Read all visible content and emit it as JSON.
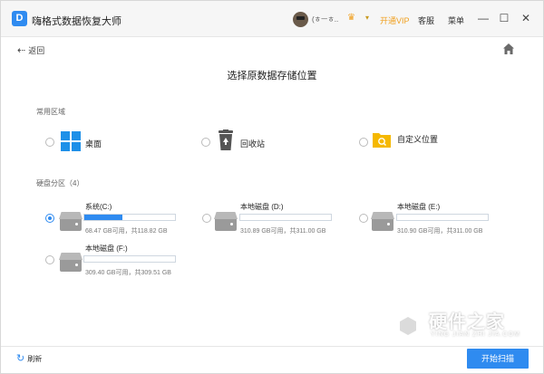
{
  "titlebar": {
    "app_title": "嗨格式数据恢复大师",
    "logo_letter": "D",
    "user_name": "(ㅎㅡㅎ..",
    "vip_label": "开通VIP",
    "service_label": "客服",
    "menu_label": "菜单",
    "min_glyph": "—",
    "max_glyph": "☐",
    "close_glyph": "✕"
  },
  "nav": {
    "back_label": "返回",
    "back_glyph": "⇠"
  },
  "page_title": "选择原数据存储位置",
  "common": {
    "section_label": "常用区域",
    "items": [
      {
        "label": "桌面",
        "icon": "windows-icon",
        "selected": false
      },
      {
        "label": "回收站",
        "icon": "recycle-bin-icon",
        "selected": false
      },
      {
        "label": "自定义位置",
        "icon": "folder-search-icon",
        "selected": false
      }
    ]
  },
  "drives": {
    "section_label": "硬盘分区（4）",
    "items": [
      {
        "name": "系统(C:)",
        "size": "68.47 GB可用，共118.82 GB",
        "used_fraction": 0.42,
        "selected": true
      },
      {
        "name": "本地磁盘 (D:)",
        "size": "310.89 GB可用，共311.00 GB",
        "used_fraction": 0.0,
        "selected": false
      },
      {
        "name": "本地磁盘 (E:)",
        "size": "310.90 GB可用，共311.00 GB",
        "used_fraction": 0.0,
        "selected": false
      },
      {
        "name": "本地磁盘 (F:)",
        "size": "309.40 GB可用，共309.51 GB",
        "used_fraction": 0.0,
        "selected": false
      }
    ]
  },
  "footer": {
    "refresh_label": "刷新",
    "refresh_glyph": "↻",
    "start_scan_label": "开始扫描"
  },
  "watermark": {
    "title": "硬件之家",
    "subtitle": "YING JIAN ZHI JIA.COM"
  },
  "colors": {
    "accent": "#2f8bf0",
    "vip": "#f0a020"
  }
}
